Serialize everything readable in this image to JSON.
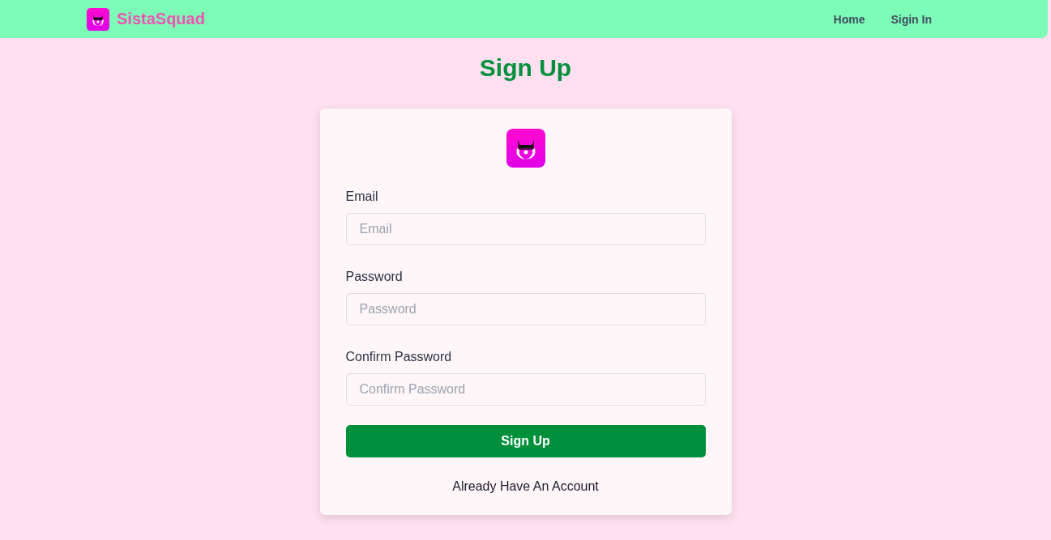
{
  "navbar": {
    "brand": "SistaSquad",
    "links": [
      {
        "label": "Home"
      },
      {
        "label": "Sigin In"
      }
    ]
  },
  "page_title": "Sign Up",
  "form": {
    "fields": [
      {
        "label": "Email",
        "placeholder": "Email"
      },
      {
        "label": "Password",
        "placeholder": "Password"
      },
      {
        "label": "Confirm Password",
        "placeholder": "Confirm Password"
      }
    ],
    "submit": "Sign Up",
    "footer_link": "Already Have An Account"
  }
}
